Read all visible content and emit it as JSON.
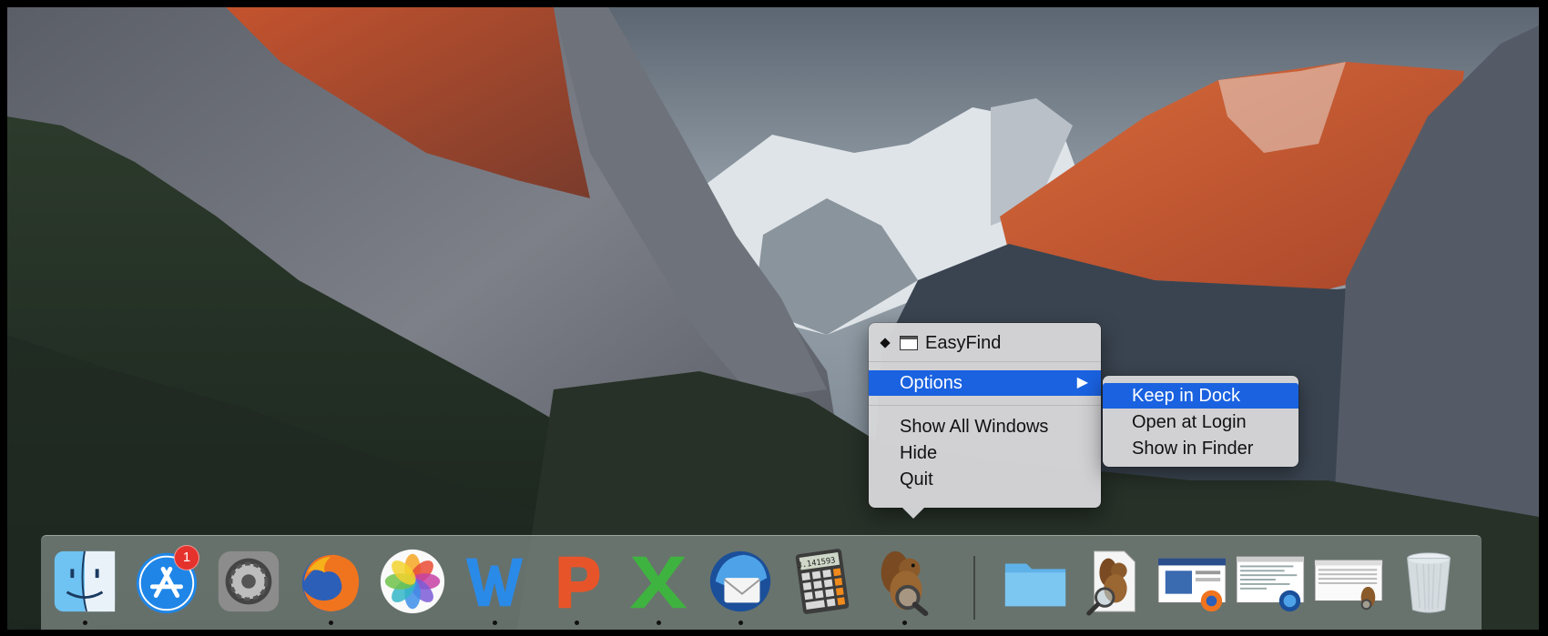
{
  "context_menu": {
    "app_name": "EasyFind",
    "options_label": "Options",
    "items": [
      "Show All Windows",
      "Hide",
      "Quit"
    ]
  },
  "submenu": {
    "items": [
      "Keep in Dock",
      "Open at Login",
      "Show in Finder"
    ]
  },
  "dock": {
    "badge_count": "1",
    "calculator_display": "3.141593",
    "apps": [
      {
        "name": "finder-icon",
        "running": true
      },
      {
        "name": "app-store-icon",
        "running": false
      },
      {
        "name": "system-preferences-icon",
        "running": false
      },
      {
        "name": "firefox-icon",
        "running": true
      },
      {
        "name": "photos-icon",
        "running": false
      },
      {
        "name": "word-icon",
        "running": true
      },
      {
        "name": "powerpoint-icon",
        "running": true
      },
      {
        "name": "excel-icon",
        "running": true
      },
      {
        "name": "thunderbird-icon",
        "running": true
      },
      {
        "name": "calculator-icon",
        "running": false
      },
      {
        "name": "easyfind-icon",
        "running": true
      }
    ],
    "stack_items": [
      "downloads-folder-icon",
      "easyfind-document-icon",
      "firefox-window-thumbnail",
      "thunderbird-window-thumbnail",
      "easyfind-window-thumbnail",
      "trash-icon"
    ]
  },
  "colors": {
    "menu_highlight": "#1a62e0",
    "menu_background": "#d6d6d8",
    "badge": "#e5322d"
  }
}
